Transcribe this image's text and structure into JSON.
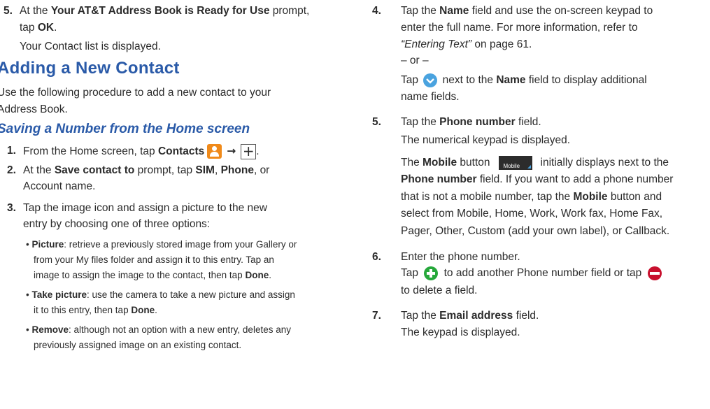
{
  "left": {
    "step5": {
      "num": "5.",
      "a": "At the ",
      "b_prompt": "Your AT&T Address Book is Ready for Use",
      "c": " prompt,",
      "d": "tap ",
      "e_ok": "OK",
      "f": ".",
      "result": "Your Contact list is displayed."
    },
    "heading": "Adding a New Contact",
    "intro1": "Use the following procedure to add a new contact to your",
    "intro2": "Address Book.",
    "subheading": "Saving a Number from the Home screen",
    "step1": {
      "num": "1.",
      "a": "From the Home screen, tap ",
      "b": "Contacts",
      "arrow": "→",
      "plus": "+",
      "end": "."
    },
    "step2": {
      "num": "2.",
      "a": "At the ",
      "b": "Save contact to",
      "c": " prompt, tap ",
      "d": "SIM",
      "e": ", ",
      "f": "Phone",
      "g": ", or",
      "line2": "Account name."
    },
    "step3": {
      "num": "3.",
      "line1": "Tap the image icon and assign a picture to the new",
      "line2": "entry by choosing one of three options:"
    },
    "bullets": [
      {
        "label": "Picture",
        "l1": ": retrieve a previously stored image from your Gallery or",
        "l2": "from your My files folder and assign it to this entry. Tap an",
        "l3a": "image to assign the image to the contact, then tap ",
        "l3b": "Done",
        "l3c": "."
      },
      {
        "label": "Take picture",
        "l1": ": use the camera to take a new picture and assign",
        "l2a": "it to this entry, then tap ",
        "l2b": "Done",
        "l2c": "."
      },
      {
        "label": "Remove",
        "l1": ": although not an option with a new entry, deletes any",
        "l2": "previously assigned image on an existing contact."
      }
    ]
  },
  "right": {
    "step4": {
      "num": "4.",
      "a": "Tap the ",
      "b": "Name",
      "c": " field and use the on-screen keypad to",
      "line2": "enter the full name. For more information, refer to",
      "ref": "“Entering Text”",
      "page": "  on page 61.",
      "or": "– or –",
      "t1": "Tap ",
      "t2": " next to the ",
      "t3": "Name",
      "t4": " field to display additional",
      "t5": "name fields."
    },
    "step5": {
      "num": "5.",
      "a": "Tap the ",
      "b": "Phone number",
      "c": " field.",
      "result": "The numerical keypad is displayed.",
      "m1": "The ",
      "m2": "Mobile",
      "m3": " button",
      "btn": "Mobile",
      "m4": "initially displays next to the",
      "p1": "Phone number",
      "p2": " field. If you want to add a phone number",
      "p3a": "that is not a mobile number, tap the ",
      "p3b": "Mobile",
      "p3c": " button and",
      "p4": "select from Mobile, Home, Work, Work fax, Home Fax,",
      "p5": "Pager, Other, Custom (add your own label), or Callback."
    },
    "step6": {
      "num": "6.",
      "a": "Enter the phone number.",
      "b1": "Tap ",
      "b2": " to add another Phone number field or tap ",
      "c": "to delete a field."
    },
    "step7": {
      "num": "7.",
      "a": "Tap the ",
      "b": "Email address",
      "c": " field.",
      "result": "The keypad is displayed."
    }
  },
  "colors": {
    "heading": "#2a5aa8",
    "contacts_icon": "#f08a1a",
    "chevron_icon": "#4aa3df",
    "add_icon": "#26a83b",
    "delete_icon": "#c8102e"
  }
}
